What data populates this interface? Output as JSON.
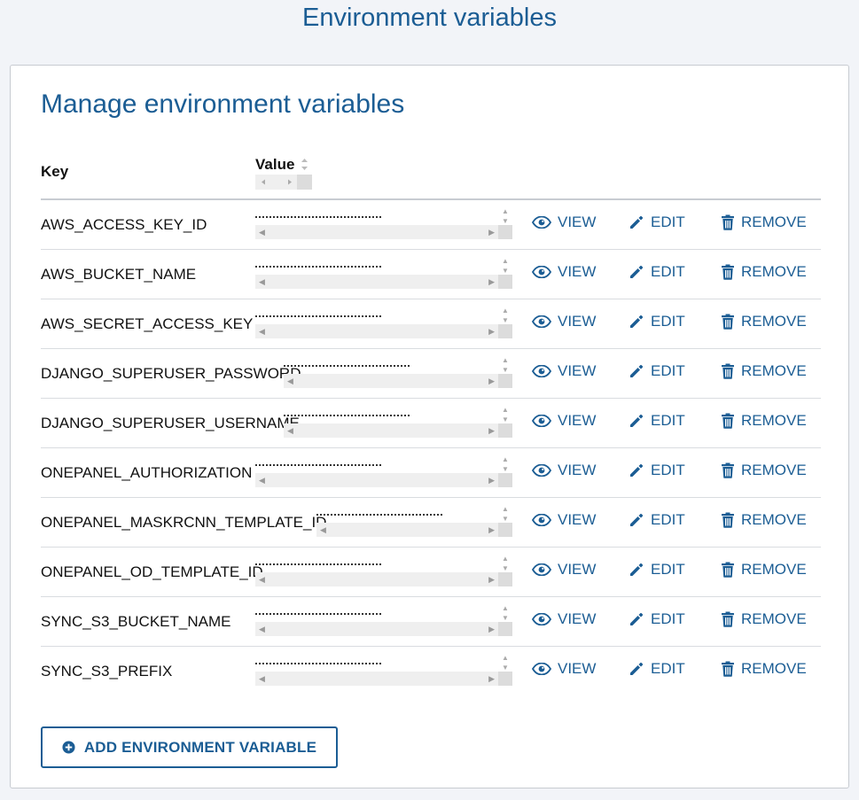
{
  "page": {
    "title": "Environment variables"
  },
  "card": {
    "title": "Manage environment variables",
    "columns": {
      "key": "Key",
      "value": "Value"
    },
    "actions": {
      "view": "VIEW",
      "edit": "EDIT",
      "remove": "REMOVE"
    },
    "rows": [
      {
        "key": "AWS_ACCESS_KEY_ID"
      },
      {
        "key": "AWS_BUCKET_NAME"
      },
      {
        "key": "AWS_SECRET_ACCESS_KEY"
      },
      {
        "key": "DJANGO_SUPERUSER_PASSWORD"
      },
      {
        "key": "DJANGO_SUPERUSER_USERNAME"
      },
      {
        "key": "ONEPANEL_AUTHORIZATION"
      },
      {
        "key": "ONEPANEL_MASKRCNN_TEMPLATE_ID"
      },
      {
        "key": "ONEPANEL_OD_TEMPLATE_ID"
      },
      {
        "key": "SYNC_S3_BUCKET_NAME"
      },
      {
        "key": "SYNC_S3_PREFIX"
      }
    ],
    "add_button": "ADD ENVIRONMENT VARIABLE"
  },
  "colors": {
    "accent": "#1b5d94",
    "background": "#f2f4f8",
    "border": "#c7cbd1"
  },
  "icons": {
    "view": "eye-icon",
    "edit": "pencil-icon",
    "remove": "trash-icon",
    "add": "plus-circle-icon"
  }
}
